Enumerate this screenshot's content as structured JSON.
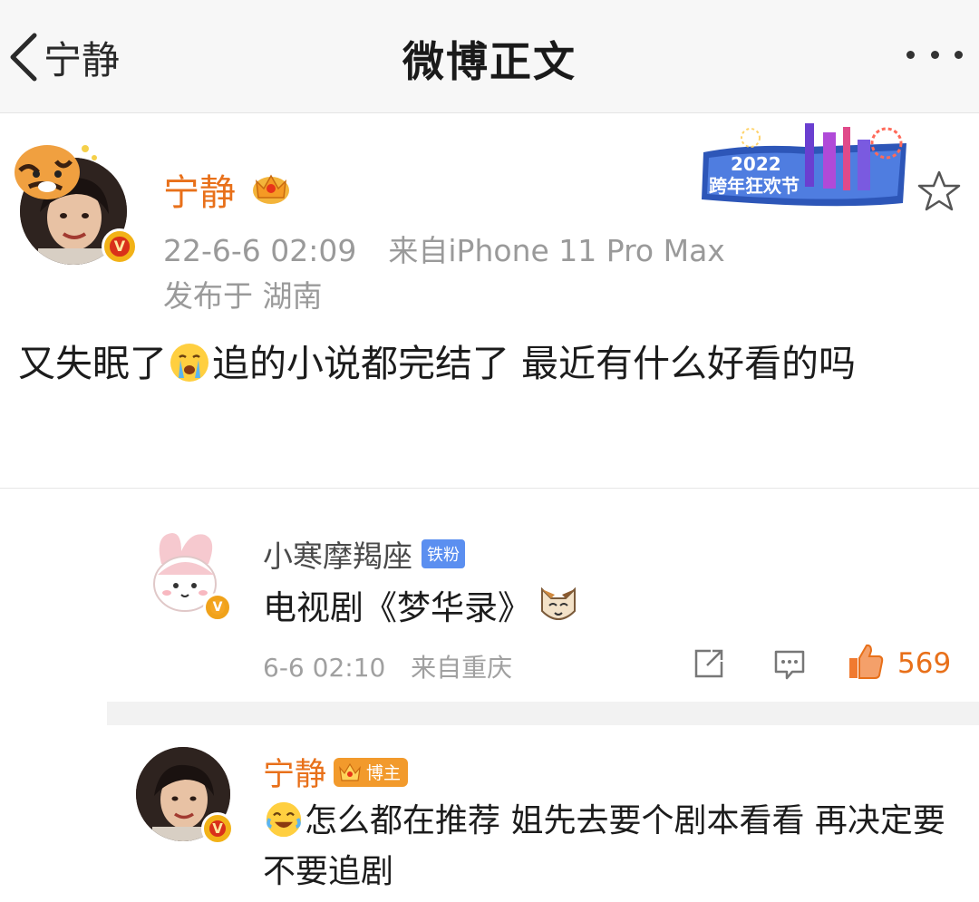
{
  "nav": {
    "back_label": "宁静",
    "title": "微博正文"
  },
  "post": {
    "username": "宁静",
    "timestamp": "22-6-6 02:09",
    "source": "来自iPhone 11 Pro Max",
    "location": "发布于 湖南",
    "text_before_emoji": "又失眠了",
    "text_after_emoji": "追的小说都完结了 最近有什么好看的吗",
    "event_banner": {
      "year": "2022",
      "label": "跨年狂欢节"
    }
  },
  "comments": [
    {
      "username": "小寒摩羯座",
      "badge": "铁粉",
      "text": "电视剧《梦华录》",
      "time": "6-6 02:10",
      "source": "来自重庆",
      "likes": "569"
    },
    {
      "username": "宁静",
      "badge": "博主",
      "text": "怎么都在推荐 姐先去要个剧本看看 再决定要不要追剧"
    }
  ],
  "colors": {
    "accent_orange": "#e8701a",
    "meta_gray": "#9a9a9a",
    "badge_blue": "#5b8ff0"
  },
  "icons": [
    "back-chevron-icon",
    "more-dots-icon",
    "crown-icon",
    "star-icon",
    "share-icon",
    "comment-icon",
    "like-icon",
    "crying-emoji-icon",
    "cat-emoji-icon",
    "laughing-emoji-icon"
  ]
}
